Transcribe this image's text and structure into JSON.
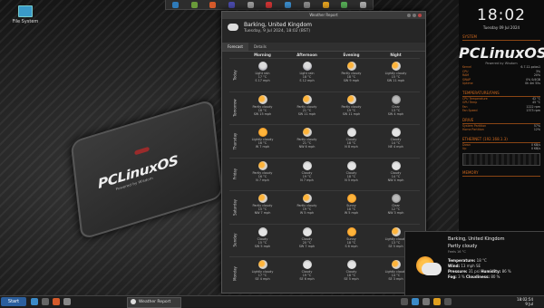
{
  "desktop": {
    "icon_label": "File System",
    "logo_text": "PCLinuxOS",
    "logo_sub": "Powered by Wisdom"
  },
  "weather": {
    "window_title": "Weather Report",
    "location": "Barking, United Kingdom",
    "datetime": "Tuesday, 9 Jul 2024, 18:02 (BST)",
    "tabs": [
      "Forecast",
      "Details"
    ],
    "headers": [
      "Morning",
      "Afternoon",
      "Evening",
      "Night"
    ],
    "days": [
      {
        "label": "Today",
        "cells": [
          {
            "icon": "rain",
            "cond": "Light rain",
            "temp": "17 °C",
            "wind": "S 17 mph"
          },
          {
            "icon": "rain",
            "cond": "Light rain",
            "temp": "18 °C",
            "wind": "S 12 mph"
          },
          {
            "icon": "pc",
            "cond": "Partly cloudy",
            "temp": "18 °C",
            "wind": "SW 9 mph"
          },
          {
            "icon": "pc",
            "cond": "Lightly cloudy",
            "temp": "15 °C",
            "wind": "SW 11 mph"
          }
        ]
      },
      {
        "label": "Tomorrow",
        "cells": [
          {
            "icon": "pc",
            "cond": "Partly cloudy",
            "temp": "18 °C",
            "wind": "SW 15 mph"
          },
          {
            "icon": "pc",
            "cond": "Partly cloudy",
            "temp": "21 °C",
            "wind": "SW 11 mph"
          },
          {
            "icon": "pc",
            "cond": "Partly cloudy",
            "temp": "19 °C",
            "wind": "SW 11 mph"
          },
          {
            "icon": "moon",
            "cond": "Clear",
            "temp": "13 °C",
            "wind": "SW 4 mph"
          }
        ]
      },
      {
        "label": "Thursday",
        "cells": [
          {
            "icon": "sun",
            "cond": "Lightly cloudy",
            "temp": "16 °C",
            "wind": "W 7 mph"
          },
          {
            "icon": "pc",
            "cond": "Partly cloudy",
            "temp": "21 °C",
            "wind": "NW 6 mph"
          },
          {
            "icon": "cloud",
            "cond": "Cloudy",
            "temp": "18 °C",
            "wind": "N 8 mph"
          },
          {
            "icon": "cloud",
            "cond": "Cloudy",
            "temp": "14 °C",
            "wind": "NE 4 mph"
          }
        ]
      },
      {
        "label": "Friday",
        "cells": [
          {
            "icon": "pc",
            "cond": "Partly cloudy",
            "temp": "16 °C",
            "wind": "N 7 mph"
          },
          {
            "icon": "cloud",
            "cond": "Cloudy",
            "temp": "19 °C",
            "wind": "N 7 mph"
          },
          {
            "icon": "cloud",
            "cond": "Cloudy",
            "temp": "18 °C",
            "wind": "N 5 mph"
          },
          {
            "icon": "cloud",
            "cond": "Cloudy",
            "temp": "14 °C",
            "wind": "NW 4 mph"
          }
        ]
      },
      {
        "label": "Saturday",
        "cells": [
          {
            "icon": "pc",
            "cond": "Partly cloudy",
            "temp": "15 °C",
            "wind": "NW 7 mph"
          },
          {
            "icon": "pc",
            "cond": "Partly cloudy",
            "temp": "19 °C",
            "wind": "W 5 mph"
          },
          {
            "icon": "sun",
            "cond": "Sunny",
            "temp": "18 °C",
            "wind": "W 5 mph"
          },
          {
            "icon": "moon",
            "cond": "Clear",
            "temp": "12 °C",
            "wind": "NW 3 mph"
          }
        ]
      },
      {
        "label": "Sunday",
        "cells": [
          {
            "icon": "cloud",
            "cond": "Cloudy",
            "temp": "15 °C",
            "wind": "SW 5 mph"
          },
          {
            "icon": "cloud",
            "cond": "Cloudy",
            "temp": "20 °C",
            "wind": "SW 7 mph"
          },
          {
            "icon": "sun",
            "cond": "Sunny",
            "temp": "18 °C",
            "wind": "S 6 mph"
          },
          {
            "icon": "pc",
            "cond": "Lightly cloudy",
            "temp": "13 °C",
            "wind": "SE 5 mph"
          }
        ]
      },
      {
        "label": "Monday",
        "cells": [
          {
            "icon": "pc",
            "cond": "Lightly cloudy",
            "temp": "17 °C",
            "wind": "SE 4 mph"
          },
          {
            "icon": "cloud",
            "cond": "Cloudy",
            "temp": "19 °C",
            "wind": "SE 6 mph"
          },
          {
            "icon": "cloud",
            "cond": "Cloudy",
            "temp": "18 °C",
            "wind": "SE 5 mph"
          },
          {
            "icon": "pc",
            "cond": "Lightly cloudy",
            "temp": "14 °C",
            "wind": "SE 3 mph"
          }
        ]
      }
    ]
  },
  "conky": {
    "time": "18:02",
    "date": "Tuesday 09 Jul 2024",
    "sections": {
      "system": "SYSTEM",
      "temps": "TEMPERATURE/FANS",
      "drive": "DRIVE",
      "network": "ETHERNET (192.168.1.3)",
      "memory": "MEMORY"
    },
    "logo": "PCLinuxOS",
    "logo_sub": "Powered by Wisdom",
    "rows": [
      {
        "k": "Kernel",
        "v": "6.7.12-pclos1"
      },
      {
        "k": "CPU",
        "v": "3%"
      },
      {
        "k": "RAM",
        "v": "20%"
      },
      {
        "k": "SWAP",
        "v": "0% 0/4GB"
      },
      {
        "k": "Uptime",
        "v": "0h 4m 55s"
      },
      {
        "k": "CPU Temperature",
        "v": "42 °C"
      },
      {
        "k": "GPU Temp",
        "v": "45 °C"
      },
      {
        "k": "Fan",
        "v": "1222 rpm"
      },
      {
        "k": "Fan Speed",
        "v": "1373 rpm"
      },
      {
        "k": "System Partition",
        "v": "57%"
      },
      {
        "k": "Home Partition",
        "v": "12%"
      },
      {
        "k": "Down",
        "v": "0 KB/s"
      },
      {
        "k": "Up",
        "v": "0 KB/s"
      }
    ]
  },
  "notification": {
    "location": "Barking, United Kingdom",
    "condition": "Partly cloudy",
    "sub": "Feels 16 °C",
    "temperature_label": "Temperature:",
    "temperature": "18 °C",
    "wind_label": "Wind:",
    "wind": "13 mph SE",
    "pressure_label": "Pressure:",
    "pressure": "31 psi",
    "humidity_label": "Humidity:",
    "humidity": "86 %",
    "fog_label": "Fog:",
    "fog": "3 %",
    "cloudiness_label": "Cloudiness:",
    "cloudiness": "80 %"
  },
  "taskbar": {
    "start_label": "Start",
    "task_label": "Weather Report",
    "clock": "18:02:54",
    "clock_date": "9 Jul"
  }
}
